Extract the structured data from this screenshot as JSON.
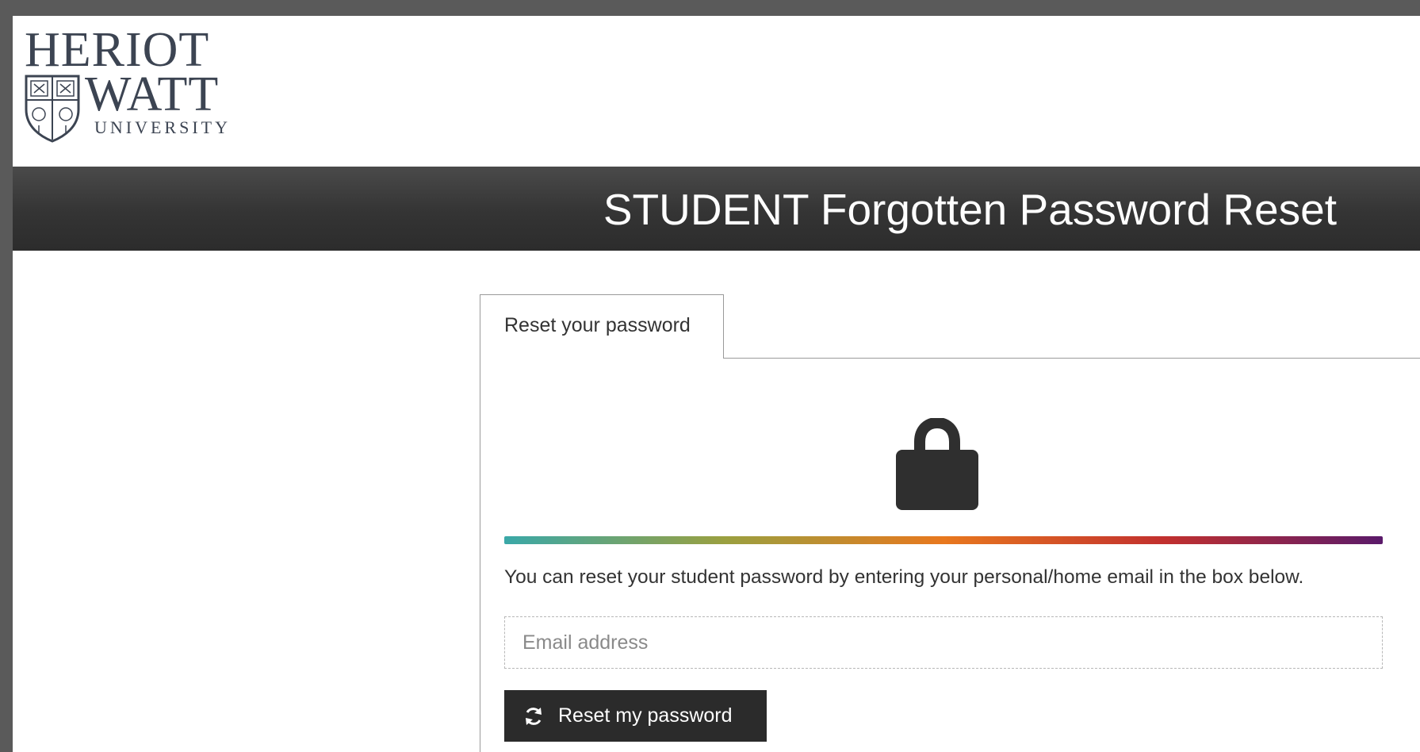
{
  "logo": {
    "line1": "HERIOT",
    "line2": "WATT",
    "line3": "UNIVERSITY"
  },
  "banner": {
    "title": "STUDENT Forgotten Password Reset"
  },
  "tabs": [
    {
      "label": "Reset your password",
      "active": true
    }
  ],
  "panel": {
    "icon": "lock-icon",
    "gradient_colors": [
      "#3aa8a8",
      "#9aa040",
      "#e8781e",
      "#c2302e",
      "#5a1a6a"
    ],
    "help_text": "You can reset your student password by entering your personal/home email in the box below.",
    "email": {
      "value": "",
      "placeholder": "Email address"
    },
    "reset_button": {
      "label": "Reset my password",
      "icon": "refresh-icon"
    }
  },
  "colors": {
    "banner": "#3e3e3e",
    "button": "#2b2b2b",
    "brand_text": "#3c4452"
  }
}
